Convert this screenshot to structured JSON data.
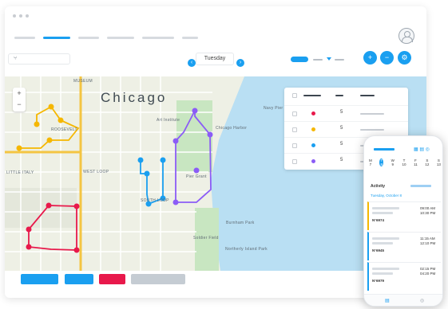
{
  "header": {
    "nav_active_index": 1
  },
  "toolbar": {
    "search_icon": "⑂",
    "prev_icon": "‹",
    "day_label": "Tuesday",
    "next_icon": "›",
    "zoom_in_icon": "+",
    "zoom_out_icon": "−",
    "settings_icon": "⚙"
  },
  "map": {
    "city_label": "Chicago",
    "zoom_in": "+",
    "zoom_out": "−",
    "labels": [
      "MUSEUM",
      "Art Institute",
      "ROOSEVELT",
      "LITTLE ITALY",
      "WEST LOOP",
      "SOUTH LOOP",
      "Chicago Harbor",
      "Navy Pier",
      "Pier Grant",
      "Burnham Park",
      "Soldier Field",
      "Northerly Island Park"
    ]
  },
  "legend": {
    "rows": [
      {
        "color": "#e8194b",
        "count": "5"
      },
      {
        "color": "#f5b700",
        "count": "5"
      },
      {
        "color": "#1a9ff0",
        "count": "5"
      },
      {
        "color": "#8b5cf6",
        "count": "5"
      }
    ]
  },
  "phone": {
    "activity_label": "Activity",
    "date_label": "Tuesday, October 8",
    "weekdays": [
      "M",
      "T",
      "W",
      "T",
      "F",
      "S",
      "S"
    ],
    "dates": [
      "7",
      "8",
      "9",
      "10",
      "11",
      "12",
      "13"
    ],
    "orders": [
      {
        "id": "N°6974",
        "time1": "09:00 AM",
        "time2": "10:30 PM"
      },
      {
        "id": "N°6945",
        "time1": "11:15 AM",
        "time2": "12:10 PM"
      },
      {
        "id": "N°6979",
        "time1": "02:15 PM",
        "time2": "04:20 PM"
      }
    ]
  },
  "colors": {
    "accent": "#1a9ff0",
    "red": "#e8194b",
    "yellow": "#f5b700",
    "blue": "#1a9ff0",
    "purple": "#8b5cf6",
    "water": "#b9dff3",
    "park": "#c8e6c1"
  }
}
